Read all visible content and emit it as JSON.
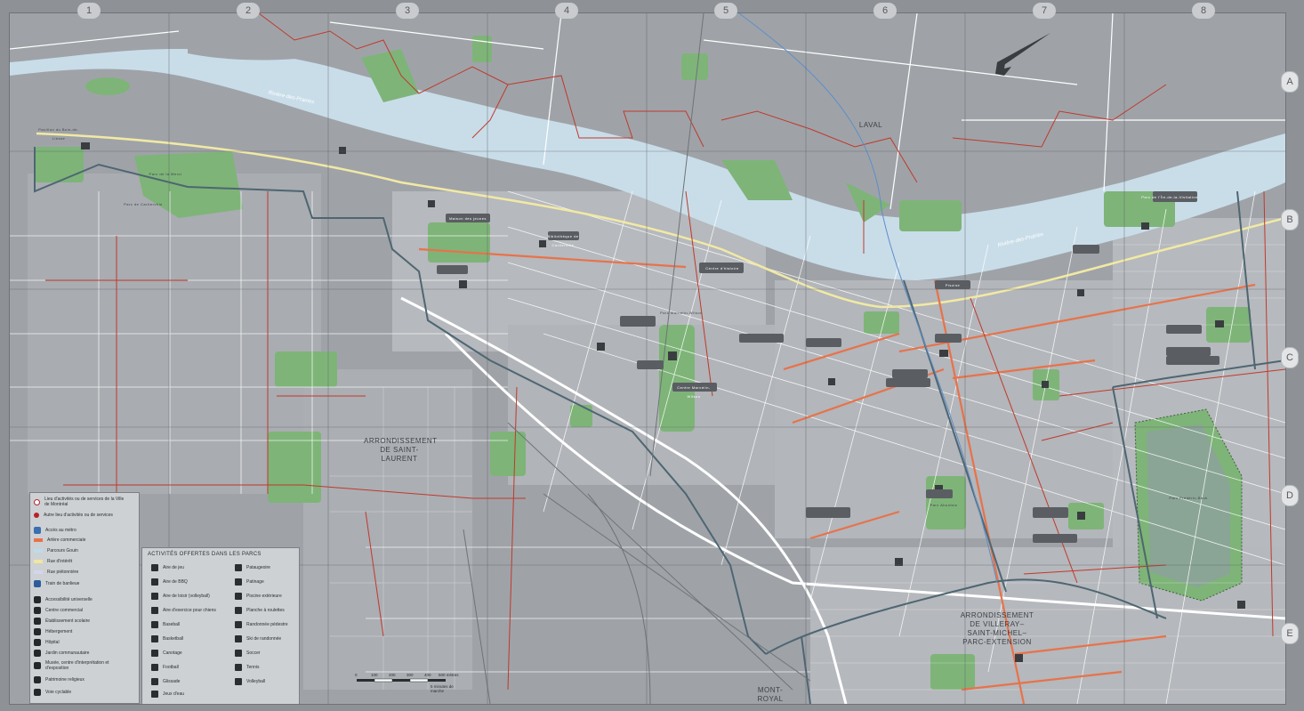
{
  "grid": {
    "columns": [
      "1",
      "2",
      "3",
      "4",
      "5",
      "6",
      "7",
      "8"
    ],
    "rows": [
      "A",
      "B",
      "C",
      "D",
      "E"
    ]
  },
  "places": {
    "laval": "LAVAL",
    "saint_laurent": "ARRONDISSEMENT DE SAINT-LAURENT",
    "villeray": "ARRONDISSEMENT DE VILLERAY–SAINT-MICHEL–PARC-EXTENSION",
    "mont_royal": "MONT-ROYAL",
    "river_1": "Rivière-des-Prairies",
    "river_2": "Rivière-des-Prairies"
  },
  "legend_services": {
    "items": [
      {
        "icon": "activity-site-icon",
        "label": "Lieu d'activités ou de services de la Ville de Montréal"
      },
      {
        "icon": "other-site-icon",
        "label": "Autre lieu d'activités ou de services"
      },
      {
        "icon": "metro-icon",
        "label": "Accès au métro"
      },
      {
        "swatch": "#e8724a",
        "label": "Artère commerciale"
      },
      {
        "swatch": "#b9dcef",
        "label": "Parcours Gouin"
      },
      {
        "swatch": "#efe6a0",
        "label": "Rue d'intérêt"
      },
      {
        "swatch": "#d3d5f0",
        "label": "Rue piétonnière"
      },
      {
        "icon": "train-icon",
        "label": "Train de banlieue"
      },
      {
        "icon": "accessibility-icon",
        "label": "Accessibilité universelle"
      },
      {
        "icon": "shopping-centre-icon",
        "label": "Centre commercial"
      },
      {
        "icon": "school-icon",
        "label": "Établissement scolaire"
      },
      {
        "icon": "lodging-icon",
        "label": "Hébergement"
      },
      {
        "icon": "hospital-icon",
        "label": "Hôpital"
      },
      {
        "icon": "community-garden-icon",
        "label": "Jardin communautaire"
      },
      {
        "icon": "museum-icon",
        "label": "Musée, centre d'interprétation et d'exposition"
      },
      {
        "icon": "religious-heritage-icon",
        "label": "Patrimoine religieux"
      },
      {
        "icon": "bike-path-icon",
        "label": "Voie cyclable"
      }
    ]
  },
  "legend_activities": {
    "title": "ACTIVITÉS OFFERTES DANS LES PARCS",
    "left": [
      {
        "icon": "playground-icon",
        "label": "Aire de jeu"
      },
      {
        "icon": "bbq-icon",
        "label": "Aire de BBQ"
      },
      {
        "icon": "leisure-area-icon",
        "label": "Aire de loisir (volleyball)"
      },
      {
        "icon": "dog-run-icon",
        "label": "Aire d'exercice pour chiens"
      },
      {
        "icon": "baseball-icon",
        "label": "Baseball"
      },
      {
        "icon": "basketball-icon",
        "label": "Basketball"
      },
      {
        "icon": "canoe-icon",
        "label": "Canotage"
      },
      {
        "icon": "football-icon",
        "label": "Football"
      },
      {
        "icon": "slide-icon",
        "label": "Glissade"
      },
      {
        "icon": "water-play-icon",
        "label": "Jeux d'eau"
      }
    ],
    "right": [
      {
        "icon": "wading-pool-icon",
        "label": "Pataugeoire"
      },
      {
        "icon": "skating-icon",
        "label": "Patinage"
      },
      {
        "icon": "outdoor-pool-icon",
        "label": "Piscine extérieure"
      },
      {
        "icon": "skatepark-icon",
        "label": "Planche à roulettes"
      },
      {
        "icon": "hiking-icon",
        "label": "Randonnée pédestre"
      },
      {
        "icon": "xc-ski-icon",
        "label": "Ski de randonnée"
      },
      {
        "icon": "soccer-icon",
        "label": "Soccer"
      },
      {
        "icon": "tennis-icon",
        "label": "Tennis"
      },
      {
        "icon": "volleyball-icon",
        "label": "Volleyball"
      }
    ]
  },
  "scale": {
    "ticks": [
      "0",
      "100",
      "200",
      "300",
      "400",
      "500 mètres"
    ],
    "walk_note": "5 minutes de marche"
  },
  "park_labels": [
    "Pavillon du Bois-de-Liesse",
    "Parc de la Merci",
    "Parc Marcelin-Wilson",
    "Centre Marcelin-Wilson",
    "Bibliothèque de Cartierville",
    "Maison des jeunes",
    "Parc de l'Île-de-la-Visitation",
    "Centre d'histoire",
    "Piscine",
    "Parc Frédéric-Back",
    "Parc de Cartierville",
    "Parc Ahuntsic"
  ],
  "colors": {
    "land": "#9fa3a8",
    "block": "#b3b6ba",
    "water": "#c9dde9",
    "park": "#7eb478",
    "road": "#ffffff",
    "commercial_artery": "#e8724a",
    "bike_path": "#c0392b",
    "gouin": "#f1e9a5",
    "boundary": "#4e6672",
    "legend_bg": "#d2d4d7"
  }
}
